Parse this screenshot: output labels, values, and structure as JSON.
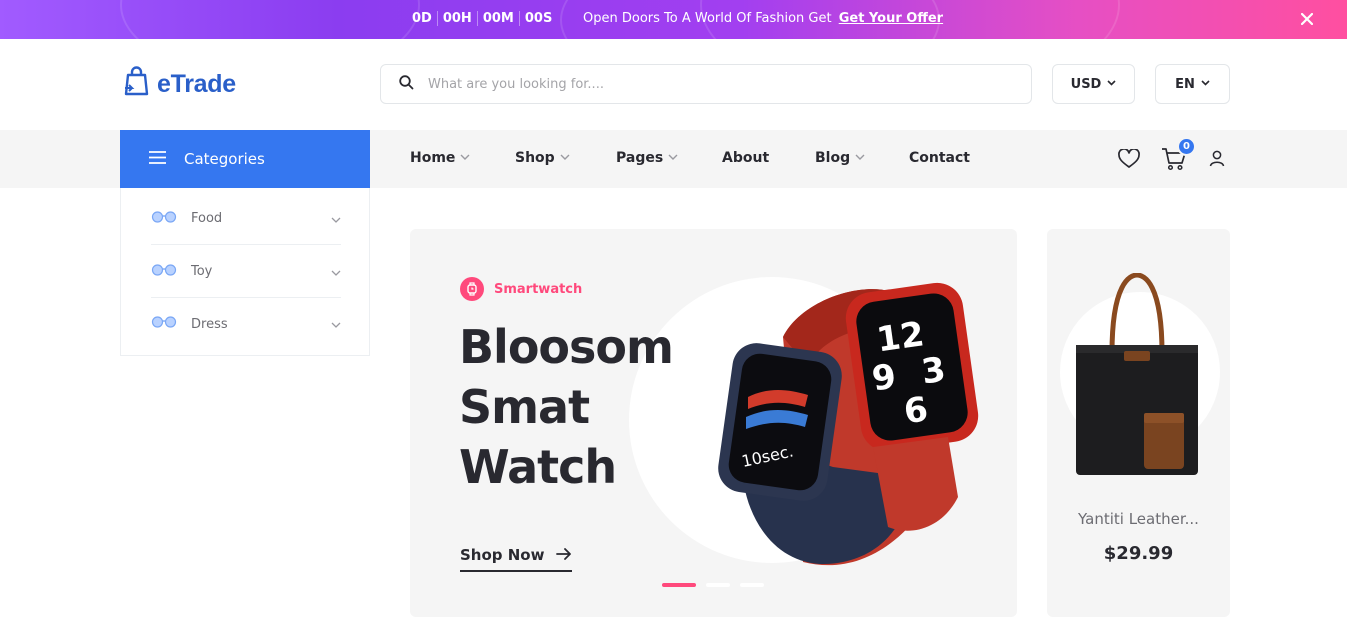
{
  "topbar": {
    "timer": [
      "0D",
      "00H",
      "00M",
      "00S"
    ],
    "promo_text": "Open Doors To A World Of Fashion Get",
    "promo_link": "Get Your Offer",
    "close_icon": "close-icon"
  },
  "header": {
    "logo_text": "eTrade",
    "logo_icon": "shopping-bag-icon",
    "search_placeholder": "What are you looking for....",
    "search_icon": "search-icon",
    "currency": "USD",
    "language": "EN"
  },
  "nav": {
    "categories_label": "Categories",
    "items": [
      {
        "label": "Home",
        "dropdown": true
      },
      {
        "label": "Shop",
        "dropdown": true
      },
      {
        "label": "Pages",
        "dropdown": true
      },
      {
        "label": "About",
        "dropdown": false
      },
      {
        "label": "Blog",
        "dropdown": true
      },
      {
        "label": "Contact",
        "dropdown": false
      }
    ],
    "cart_count": "0",
    "icons": [
      "heart-icon",
      "cart-icon",
      "user-icon"
    ]
  },
  "categories": [
    {
      "label": "Food"
    },
    {
      "label": "Toy"
    },
    {
      "label": "Dress"
    }
  ],
  "hero": {
    "tag": "Smartwatch",
    "title_lines": [
      "Bloosom",
      "Smat",
      "Watch"
    ],
    "cta": "Shop Now",
    "active_slide": 1,
    "slide_count": 3
  },
  "side_product": {
    "name": "Yantiti Leather...",
    "price": "$29.99"
  },
  "colors": {
    "primary": "#3577f0",
    "accent": "#ff497c",
    "text": "#292930"
  }
}
